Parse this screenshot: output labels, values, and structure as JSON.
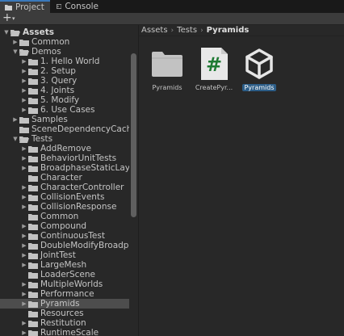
{
  "tabs": [
    {
      "label": "Project",
      "icon": "folder-icon"
    },
    {
      "label": "Console",
      "icon": "console-icon"
    }
  ],
  "toolbar": {
    "add_label": "+",
    "dropdown_glyph": "▾"
  },
  "breadcrumb": [
    "Assets",
    "Tests",
    "Pyramids"
  ],
  "tree": [
    {
      "label": "Assets",
      "depth": 0,
      "expanded": true,
      "has_children": true,
      "bold": true
    },
    {
      "label": "Common",
      "depth": 1,
      "expanded": false,
      "has_children": true
    },
    {
      "label": "Demos",
      "depth": 1,
      "expanded": true,
      "has_children": true
    },
    {
      "label": "1. Hello World",
      "depth": 2,
      "expanded": false,
      "has_children": true
    },
    {
      "label": "2. Setup",
      "depth": 2,
      "expanded": false,
      "has_children": true
    },
    {
      "label": "3. Query",
      "depth": 2,
      "expanded": false,
      "has_children": true
    },
    {
      "label": "4. Joints",
      "depth": 2,
      "expanded": false,
      "has_children": true
    },
    {
      "label": "5. Modify",
      "depth": 2,
      "expanded": false,
      "has_children": true
    },
    {
      "label": "6. Use Cases",
      "depth": 2,
      "expanded": false,
      "has_children": true
    },
    {
      "label": "Samples",
      "depth": 1,
      "expanded": false,
      "has_children": true
    },
    {
      "label": "SceneDependencyCache",
      "depth": 1,
      "expanded": false,
      "has_children": false
    },
    {
      "label": "Tests",
      "depth": 1,
      "expanded": true,
      "has_children": true
    },
    {
      "label": "AddRemove",
      "depth": 2,
      "expanded": false,
      "has_children": true
    },
    {
      "label": "BehaviorUnitTests",
      "depth": 2,
      "expanded": false,
      "has_children": true
    },
    {
      "label": "BroadphaseStaticLayerCha",
      "depth": 2,
      "expanded": false,
      "has_children": true
    },
    {
      "label": "Character",
      "depth": 2,
      "expanded": false,
      "has_children": false
    },
    {
      "label": "CharacterController",
      "depth": 2,
      "expanded": false,
      "has_children": true
    },
    {
      "label": "CollisionEvents",
      "depth": 2,
      "expanded": false,
      "has_children": true
    },
    {
      "label": "CollisionResponse",
      "depth": 2,
      "expanded": false,
      "has_children": true
    },
    {
      "label": "Common",
      "depth": 2,
      "expanded": false,
      "has_children": false
    },
    {
      "label": "Compound",
      "depth": 2,
      "expanded": false,
      "has_children": true
    },
    {
      "label": "ContinuousTest",
      "depth": 2,
      "expanded": false,
      "has_children": true
    },
    {
      "label": "DoubleModifyBroadphaseF",
      "depth": 2,
      "expanded": false,
      "has_children": true
    },
    {
      "label": "JointTest",
      "depth": 2,
      "expanded": false,
      "has_children": true
    },
    {
      "label": "LargeMesh",
      "depth": 2,
      "expanded": false,
      "has_children": true
    },
    {
      "label": "LoaderScene",
      "depth": 2,
      "expanded": false,
      "has_children": false
    },
    {
      "label": "MultipleWorlds",
      "depth": 2,
      "expanded": false,
      "has_children": true
    },
    {
      "label": "Performance",
      "depth": 2,
      "expanded": false,
      "has_children": true
    },
    {
      "label": "Pyramids",
      "depth": 2,
      "expanded": false,
      "has_children": true,
      "selected": true
    },
    {
      "label": "Resources",
      "depth": 2,
      "expanded": false,
      "has_children": false
    },
    {
      "label": "Restitution",
      "depth": 2,
      "expanded": false,
      "has_children": true
    },
    {
      "label": "RuntimeScale",
      "depth": 2,
      "expanded": false,
      "has_children": true
    }
  ],
  "assets": [
    {
      "name": "Pyramids",
      "type": "folder",
      "icon": "folder-icon",
      "selected": false
    },
    {
      "name": "CreatePyr...",
      "type": "script",
      "icon": "csharp-script-icon",
      "glyph": "#",
      "selected": false
    },
    {
      "name": "Pyramids",
      "type": "scene",
      "icon": "unity-scene-icon",
      "selected": true
    }
  ],
  "colors": {
    "accent": "#3a79bb",
    "selection": "#2c5d87",
    "folder": "#c2c2c2",
    "script_glyph": "#1f7a33"
  }
}
